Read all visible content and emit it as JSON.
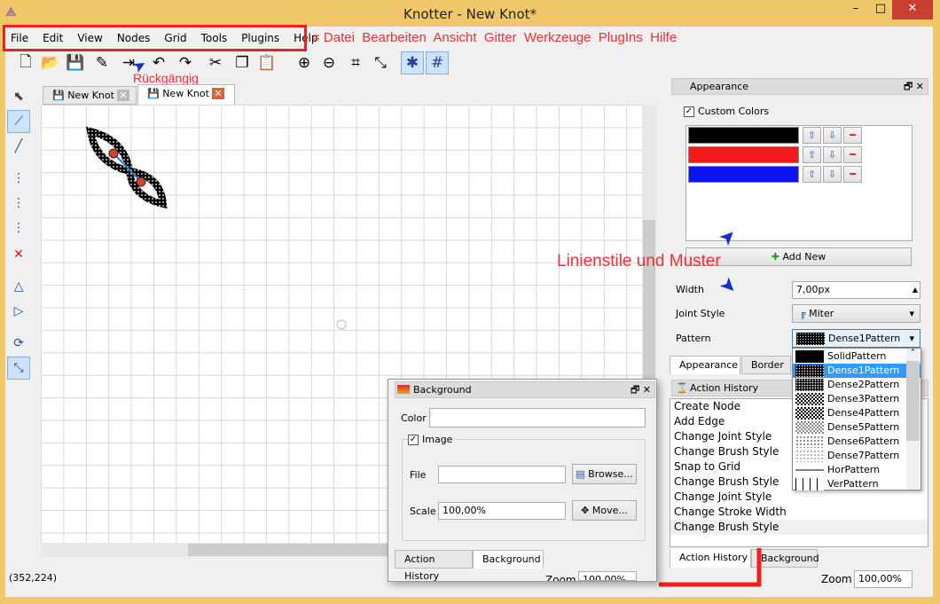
{
  "window": {
    "title": "Knotter - New Knot*",
    "minimize": "–",
    "maximize": "□",
    "close": "✕"
  },
  "menu": [
    "File",
    "Edit",
    "View",
    "Nodes",
    "Grid",
    "Tools",
    "Plugins",
    "Help"
  ],
  "annotations": {
    "menu_translation": "= Datei  Bearbeiten  Ansicht  Gitter  Werkzeuge  PlugIns  Hilfe",
    "undo": "Rückgängig",
    "styles": "Linienstile und Muster"
  },
  "toolbar": [
    {
      "icon": "new-icon",
      "g": "🗋"
    },
    {
      "icon": "open-icon",
      "g": "📂"
    },
    {
      "icon": "save-icon",
      "g": "💾"
    },
    {
      "icon": "save-as-icon",
      "g": "✎"
    },
    {
      "icon": "export-icon",
      "g": "⇥"
    },
    {
      "icon": "undo-icon",
      "g": "↶"
    },
    {
      "icon": "redo-icon",
      "g": "↷"
    },
    {
      "icon": "cut-icon",
      "g": "✂"
    },
    {
      "icon": "copy-icon",
      "g": "❐"
    },
    {
      "icon": "paste-icon",
      "g": "📋"
    },
    {
      "icon": "zoom-in-icon",
      "g": "⊕"
    },
    {
      "icon": "zoom-out-icon",
      "g": "⊖"
    },
    {
      "icon": "reset-view-icon",
      "g": "⌗"
    },
    {
      "icon": "fit-icon",
      "g": "⤡"
    },
    {
      "icon": "knot-display-icon",
      "g": "✱"
    },
    {
      "icon": "grid-icon",
      "g": "#"
    }
  ],
  "tabs": [
    {
      "label": "New Knot"
    },
    {
      "label": "New Knot"
    }
  ],
  "status": {
    "coords": "(352,224)"
  },
  "appearance": {
    "title": "Appearance",
    "custom_colors": "Custom Colors",
    "colors": [
      "#000000",
      "#ee1c1c",
      "#0a14f0"
    ],
    "add_new": "Add New",
    "width_label": "Width",
    "width_value": "7,00px",
    "joint_label": "Joint Style",
    "joint_value": "Miter",
    "pattern_label": "Pattern",
    "pattern_value": "Dense1Pattern",
    "tabs": [
      "Appearance",
      "Border"
    ]
  },
  "pattern_options": [
    "SolidPattern",
    "Dense1Pattern",
    "Dense2Pattern",
    "Dense3Pattern",
    "Dense4Pattern",
    "Dense5Pattern",
    "Dense6Pattern",
    "Dense7Pattern",
    "HorPattern",
    "VerPattern"
  ],
  "history": {
    "title": "Action History",
    "items": [
      "Create Node",
      "Add Edge",
      "Change Joint Style",
      "Change Brush Style",
      "Snap to Grid",
      "Change Brush Style",
      "Change Joint Style",
      "Change Stroke Width",
      "Change Brush Style"
    ],
    "tabs": [
      "Action History",
      "Background"
    ],
    "zoom_label": "Zoom",
    "zoom_value": "100,00%"
  },
  "background": {
    "title": "Background",
    "color_label": "Color",
    "image_label": "Image",
    "file_label": "File",
    "browse": "Browse...",
    "scale_label": "Scale",
    "scale_value": "100,00%",
    "move": "Move...",
    "tabs": [
      "Action History",
      "Background"
    ],
    "zoom_label": "Zoom",
    "zoom_value": "100,00%"
  }
}
